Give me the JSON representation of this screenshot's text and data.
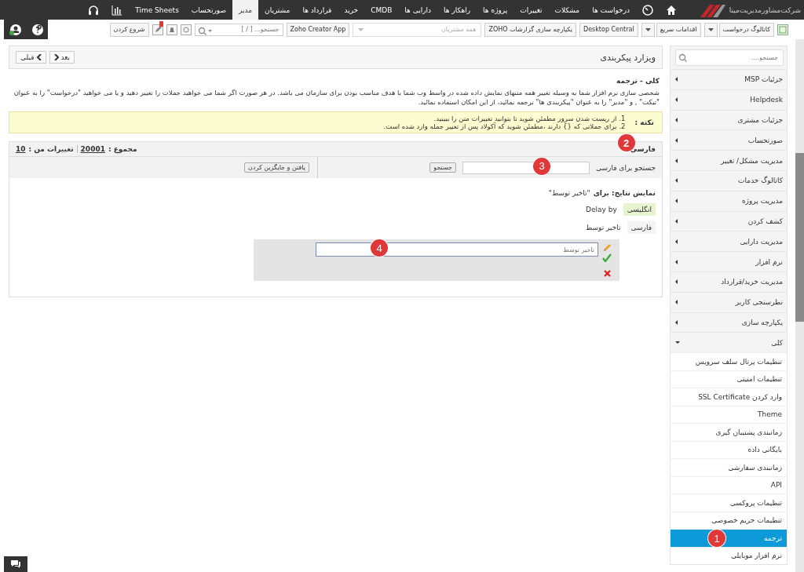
{
  "nav": {
    "logo": "شرکت‌مشاورمدیریت‌مینا",
    "items": [
      {
        "label": "درخواست ها",
        "selected": false
      },
      {
        "label": "مشکلات",
        "selected": false
      },
      {
        "label": "تغییرات",
        "selected": false
      },
      {
        "label": "پروژه ها",
        "selected": false
      },
      {
        "label": "راهکار ها",
        "selected": false
      },
      {
        "label": "دارایی ها",
        "selected": false
      },
      {
        "label": "CMDB",
        "selected": false
      },
      {
        "label": "خرید",
        "selected": false
      },
      {
        "label": "قرارداد ها",
        "selected": false
      },
      {
        "label": "مشتریان",
        "selected": false
      },
      {
        "label": "مدیر",
        "selected": true
      },
      {
        "label": "صورتحساب",
        "selected": false
      },
      {
        "label": "Time Sheets",
        "selected": false
      }
    ]
  },
  "toolbar": {
    "buttons": [
      {
        "label": "کاتالوگ درخواست",
        "kind": "dropdown"
      },
      {
        "label": "اقدامات سریع",
        "kind": "dropdown"
      },
      {
        "label": "Desktop Central",
        "kind": "plain"
      },
      {
        "label": "یکپارچه سازی گزارشات ZOHO",
        "kind": "plain"
      },
      {
        "label": "همه مشتریان",
        "kind": "select"
      },
      {
        "label": "Zoho Creator App",
        "kind": "plain"
      }
    ],
    "search": {
      "placeholder": "جستجو... [ / ]"
    },
    "start_button": "شروع کردن"
  },
  "header": {
    "title": "ویزارد پیکربندی",
    "prev": "قبلی",
    "next": "بعد"
  },
  "breadcrumb": "کلی - ترجمه",
  "description": "شخصی سازی نرم افزار شما به وسیله تغییر همه متنهای نمایش داده شده در واسط وب شما با هدف مناسب بودن برای سازمان می باشد. در هر صورت اگر شما می خواهید جملات را تغییر دهید و یا می خواهید \"درخواست\" را به عنوان \"تیکت\" , و \"مدیر\" را به عنوان \"پیکربندی ها\" ترجمه نمائید، از این امکان استفاده نمائید.",
  "note": {
    "label": "نکته :",
    "items": [
      {
        "number": "1.",
        "text": "از ریست شدن سرور مطمئن شوید تا بتوانید تغییرات متن را ببینید."
      },
      {
        "number": "2.",
        "text": "برای جملاتی که {} دارند ،مطمئن شوید که آکولاد پس از تغییر جمله وارد شده است."
      }
    ]
  },
  "language_bar": {
    "language": "فارسی",
    "marker": "2",
    "total_label": "مجموع :",
    "total": "20001",
    "changes_label": "تغییرات من :",
    "changes": "10"
  },
  "search": {
    "label": "جستجو برای فارسی",
    "marker": "3",
    "button": "جستجو",
    "find_replace": "یافتن و جایگزین کردن"
  },
  "results": {
    "title": "نمایش نتایج: برای",
    "query": "\"تاخیر توسط\"",
    "rows": [
      {
        "language": "انگلیسی",
        "text": "Delay by",
        "selected": true
      },
      {
        "language": "فارسی",
        "text": "تاخیر توسط",
        "selected": false
      }
    ],
    "editor": {
      "placeholder": "تاخیر توسط",
      "marker": "4"
    }
  },
  "sidebar": {
    "search": {
      "placeholder": "جستجو...."
    },
    "items": [
      {
        "label": "جزئیات MSP",
        "expanded": false
      },
      {
        "label": "Helpdesk",
        "expanded": false
      },
      {
        "label": "جزئیات مشتری",
        "expanded": false
      },
      {
        "label": "صورتحساب",
        "expanded": false
      },
      {
        "label": "مدیریت مشکل/ تغییر",
        "expanded": false
      },
      {
        "label": "کاتالوگ خدمات",
        "expanded": false
      },
      {
        "label": "مدیریت پروژه",
        "expanded": false
      },
      {
        "label": "کشف کردن",
        "expanded": false
      },
      {
        "label": "مدیریت دارایی",
        "expanded": false
      },
      {
        "label": "نرم افزار",
        "expanded": false
      },
      {
        "label": "مدیریت خرید/قرارداد",
        "expanded": false
      },
      {
        "label": "نظرسنجی کاربر",
        "expanded": false
      },
      {
        "label": "یکپارچه سازی",
        "expanded": false
      },
      {
        "label": "کلی",
        "expanded": true,
        "children": [
          {
            "label": "تنظیمات پرتال سلف سرویس",
            "selected": false
          },
          {
            "label": "تنظیمات امنیتی",
            "selected": false
          },
          {
            "label": "وارد کردن SSL Certificate",
            "selected": false
          },
          {
            "label": "Theme",
            "selected": false
          },
          {
            "label": "زمانبندی پشتیبان گیری",
            "selected": false
          },
          {
            "label": "بایگانی داده",
            "selected": false
          },
          {
            "label": "زمانبندی سفارشی",
            "selected": false
          },
          {
            "label": "API",
            "selected": false
          },
          {
            "label": "تنظیمات پروکسی",
            "selected": false
          },
          {
            "label": "تنظیمات حریم خصوصی",
            "selected": false
          },
          {
            "label": "ترجمه",
            "selected": true,
            "marker": "1"
          },
          {
            "label": "نرم افزار موبایلی",
            "selected": false
          }
        ]
      }
    ]
  }
}
